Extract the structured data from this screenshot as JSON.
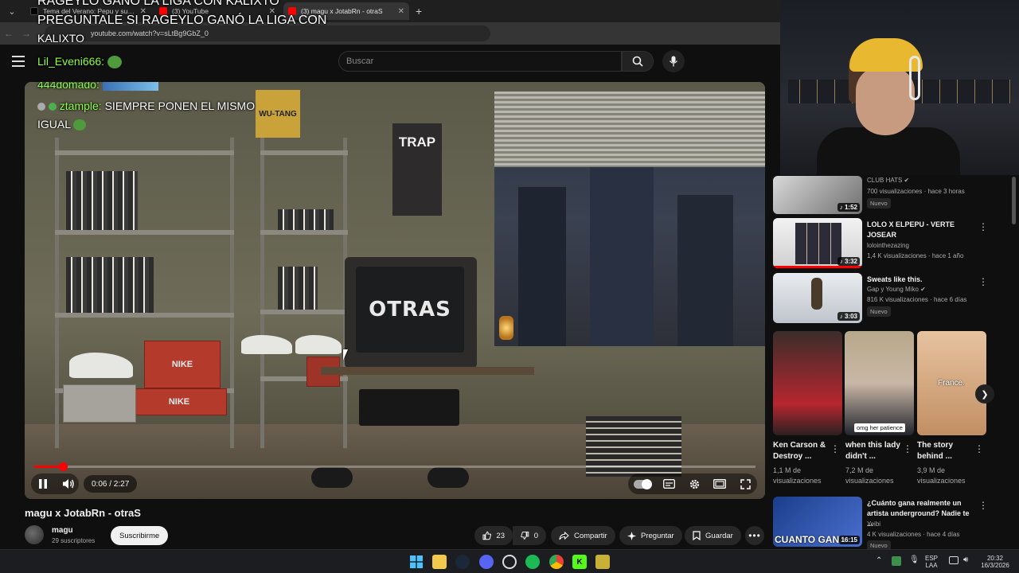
{
  "browser": {
    "tabs": [
      {
        "title": "Tema del Verano: Pepu y su Ex",
        "active": false,
        "icon": "tiktok-icon"
      },
      {
        "title": "(3) YouTube",
        "active": false,
        "icon": "youtube-icon"
      },
      {
        "title": "(3) magu x JotabRn - otraS",
        "active": true,
        "icon": "youtube-icon"
      }
    ],
    "new_tab": "+",
    "url": "youtube.com/watch?v=sLtBg9GbZ_0"
  },
  "overlay": {
    "banner_line1": "RAGEYLO GANÓ LA LIGA CON KALIXTO",
    "banner_line2": "PREGUNTALE SI RAGEYLO GANÓ LA LIGA CON",
    "banner_line3": "KALIXTO",
    "user1": "Lil_Eveni666:",
    "user2": "444domado:",
    "user3": "ztample:",
    "message3_a": "SIEMPRE PONEN EL MISMO",
    "message3_b": "IGUAL"
  },
  "search": {
    "placeholder": "Buscar"
  },
  "player": {
    "tv_text": "OTRAS",
    "box_text": "NIKE",
    "poster_text": "TRAP",
    "poster2_text": "WU-TANG",
    "time": "0:06 / 2:27",
    "progress": 0.04
  },
  "video": {
    "title": "magu x JotabRn - otraS",
    "channel": "magu",
    "subscribers": "29 suscriptores",
    "subscribe": "Suscribirme",
    "likes": "23",
    "dislikes": "0",
    "share": "Compartir",
    "ask": "Preguntar",
    "save": "Guardar"
  },
  "recommendations": [
    {
      "title": "",
      "channel": "CLUB HATS",
      "meta": "700 visualizaciones · hace 3 horas",
      "badge": "Nuevo",
      "duration": "1:52",
      "verified": true
    },
    {
      "title": "LOLO X ELPEPU - VERTE JOSEAR",
      "channel": "lolointhezazing",
      "meta": "1,4 K visualizaciones · hace 1 año",
      "badge": "",
      "duration": "3:32",
      "verified": false
    },
    {
      "title": "Sweats like this.",
      "channel": "Gap y Young Miko",
      "meta": "816 K visualizaciones · hace 6 días",
      "badge": "Nuevo",
      "duration": "3:03",
      "verified": true
    }
  ],
  "shorts": [
    {
      "title": "Ken Carson & Destroy ...",
      "views": "1,1 M de visualizaciones",
      "overlay": ""
    },
    {
      "title": "when this lady didn't ...",
      "views": "7,2 M de visualizaciones",
      "overlay": "omg her patience"
    },
    {
      "title": "The story behind ...",
      "views": "3,9 M de visualizaciones",
      "overlay": "France."
    }
  ],
  "bottom_rec": {
    "title": "¿Cuánto gana realmente un artista underground? Nadie te ...",
    "channel": "Yeibi",
    "meta": "4 K visualizaciones · hace 4 días",
    "badge": "Nuevo",
    "duration": "16:15",
    "thumb_text": "CUANTO GANA"
  },
  "taskbar": {
    "lang1": "ESP",
    "lang2": "LAA",
    "time": "20:32",
    "date": "16/3/2026"
  },
  "colors": {
    "accent": "#ff0000",
    "background": "#0f0f0f",
    "chat_green": "#8dff4a"
  }
}
